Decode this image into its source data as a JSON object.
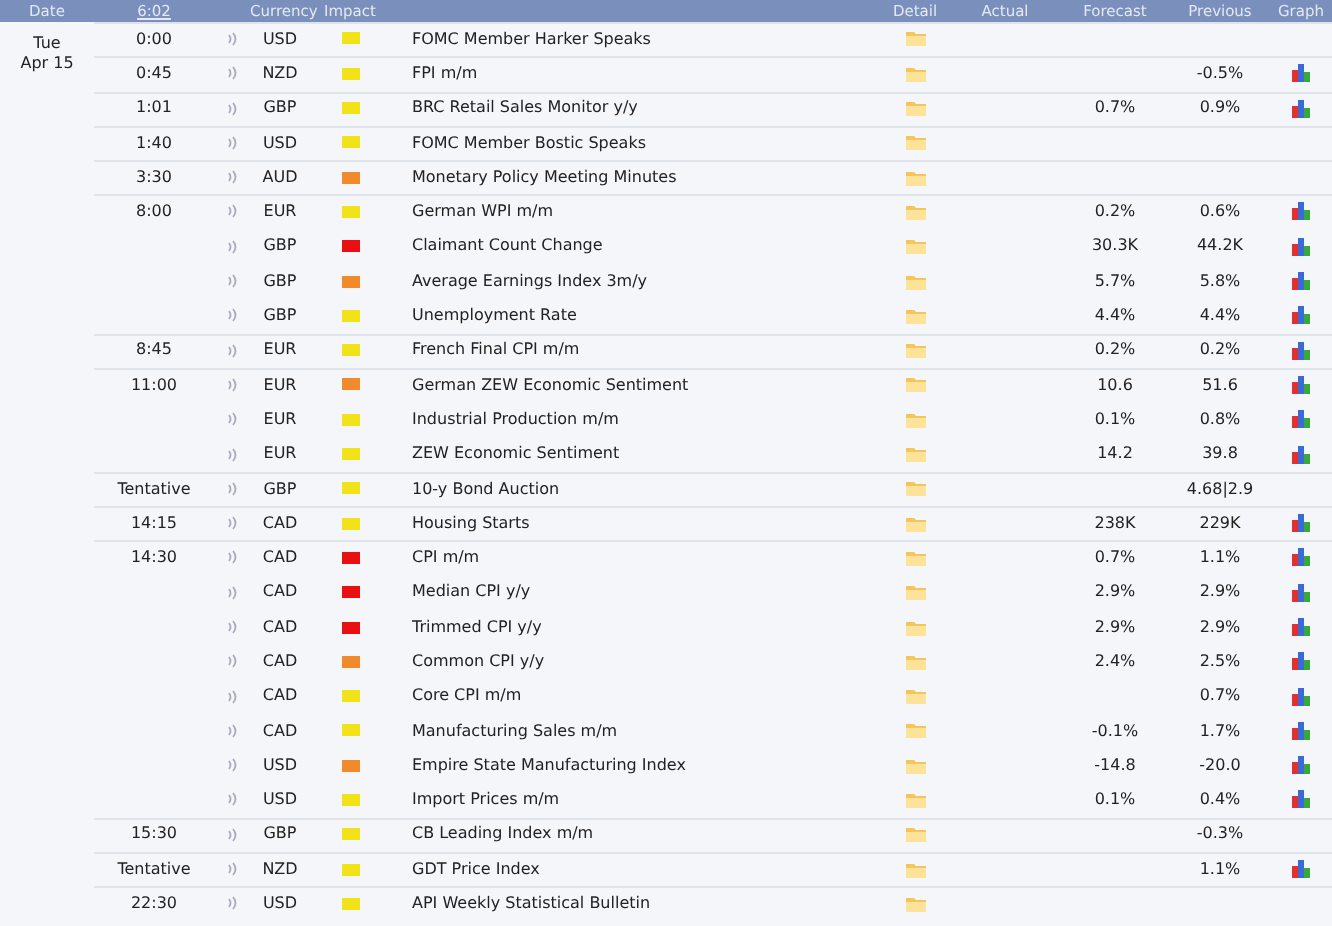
{
  "header": {
    "date": "Date",
    "time": "6:02",
    "currency": "Currency",
    "impact": "Impact",
    "detail": "Detail",
    "actual": "Actual",
    "forecast": "Forecast",
    "previous": "Previous",
    "graph": "Graph"
  },
  "date": {
    "weekday": "Tue",
    "day": "Apr 15"
  },
  "events": [
    {
      "time": "0:00",
      "currency": "USD",
      "color": "#f2e21a",
      "event": "FOMC Member Harker Speaks",
      "graph": false
    },
    {
      "time": "0:45",
      "currency": "NZD",
      "color": "#f2e21a",
      "event": "FPI m/m",
      "previous": "-0.5%",
      "graph": true
    },
    {
      "time": "1:01",
      "currency": "GBP",
      "color": "#f2e21a",
      "event": "BRC Retail Sales Monitor y/y",
      "forecast": "0.7%",
      "previous": "0.9%",
      "graph": true
    },
    {
      "time": "1:40",
      "currency": "USD",
      "color": "#f2e21a",
      "event": "FOMC Member Bostic Speaks",
      "graph": false
    },
    {
      "time": "3:30",
      "currency": "AUD",
      "color": "#f08a2a",
      "event": "Monetary Policy Meeting Minutes",
      "graph": false
    },
    {
      "time": "8:00",
      "currency": "EUR",
      "color": "#f2e21a",
      "event": "German WPI m/m",
      "forecast": "0.2%",
      "previous": "0.6%",
      "graph": true
    },
    {
      "currency": "GBP",
      "color": "#e81010",
      "event": "Claimant Count Change",
      "forecast": "30.3K",
      "previous": "44.2K",
      "graph": true
    },
    {
      "currency": "GBP",
      "color": "#f08a2a",
      "event": "Average Earnings Index 3m/y",
      "forecast": "5.7%",
      "previous": "5.8%",
      "graph": true
    },
    {
      "currency": "GBP",
      "color": "#f2e21a",
      "event": "Unemployment Rate",
      "forecast": "4.4%",
      "previous": "4.4%",
      "graph": true
    },
    {
      "time": "8:45",
      "currency": "EUR",
      "color": "#f2e21a",
      "event": "French Final CPI m/m",
      "forecast": "0.2%",
      "previous": "0.2%",
      "graph": true
    },
    {
      "time": "11:00",
      "currency": "EUR",
      "color": "#f08a2a",
      "event": "German ZEW Economic Sentiment",
      "forecast": "10.6",
      "previous": "51.6",
      "graph": true
    },
    {
      "currency": "EUR",
      "color": "#f2e21a",
      "event": "Industrial Production m/m",
      "forecast": "0.1%",
      "previous": "0.8%",
      "graph": true
    },
    {
      "currency": "EUR",
      "color": "#f2e21a",
      "event": "ZEW Economic Sentiment",
      "forecast": "14.2",
      "previous": "39.8",
      "graph": true
    },
    {
      "time": "Tentative",
      "currency": "GBP",
      "color": "#f2e21a",
      "event": "10-y Bond Auction",
      "previous": "4.68|2.9",
      "graph": false
    },
    {
      "time": "14:15",
      "currency": "CAD",
      "color": "#f2e21a",
      "event": "Housing Starts",
      "forecast": "238K",
      "previous": "229K",
      "graph": true
    },
    {
      "time": "14:30",
      "currency": "CAD",
      "color": "#e81010",
      "event": "CPI m/m",
      "forecast": "0.7%",
      "previous": "1.1%",
      "graph": true
    },
    {
      "currency": "CAD",
      "color": "#e81010",
      "event": "Median CPI y/y",
      "forecast": "2.9%",
      "previous": "2.9%",
      "graph": true
    },
    {
      "currency": "CAD",
      "color": "#e81010",
      "event": "Trimmed CPI y/y",
      "forecast": "2.9%",
      "previous": "2.9%",
      "graph": true
    },
    {
      "currency": "CAD",
      "color": "#f08a2a",
      "event": "Common CPI y/y",
      "forecast": "2.4%",
      "previous": "2.5%",
      "graph": true
    },
    {
      "currency": "CAD",
      "color": "#f2e21a",
      "event": "Core CPI m/m",
      "previous": "0.7%",
      "graph": true
    },
    {
      "currency": "CAD",
      "color": "#f2e21a",
      "event": "Manufacturing Sales m/m",
      "forecast": "-0.1%",
      "previous": "1.7%",
      "graph": true
    },
    {
      "currency": "USD",
      "color": "#f08a2a",
      "event": "Empire State Manufacturing Index",
      "forecast": "-14.8",
      "previous": "-20.0",
      "graph": true
    },
    {
      "currency": "USD",
      "color": "#f2e21a",
      "event": "Import Prices m/m",
      "forecast": "0.1%",
      "previous": "0.4%",
      "graph": true
    },
    {
      "time": "15:30",
      "currency": "GBP",
      "color": "#f2e21a",
      "event": "CB Leading Index m/m",
      "previous": "-0.3%",
      "graph": false
    },
    {
      "time": "Tentative",
      "currency": "NZD",
      "color": "#f2e21a",
      "event": "GDT Price Index",
      "previous": "1.1%",
      "graph": true
    },
    {
      "time": "22:30",
      "currency": "USD",
      "color": "#f2e21a",
      "event": "API Weekly Statistical Bulletin",
      "graph": false
    }
  ]
}
